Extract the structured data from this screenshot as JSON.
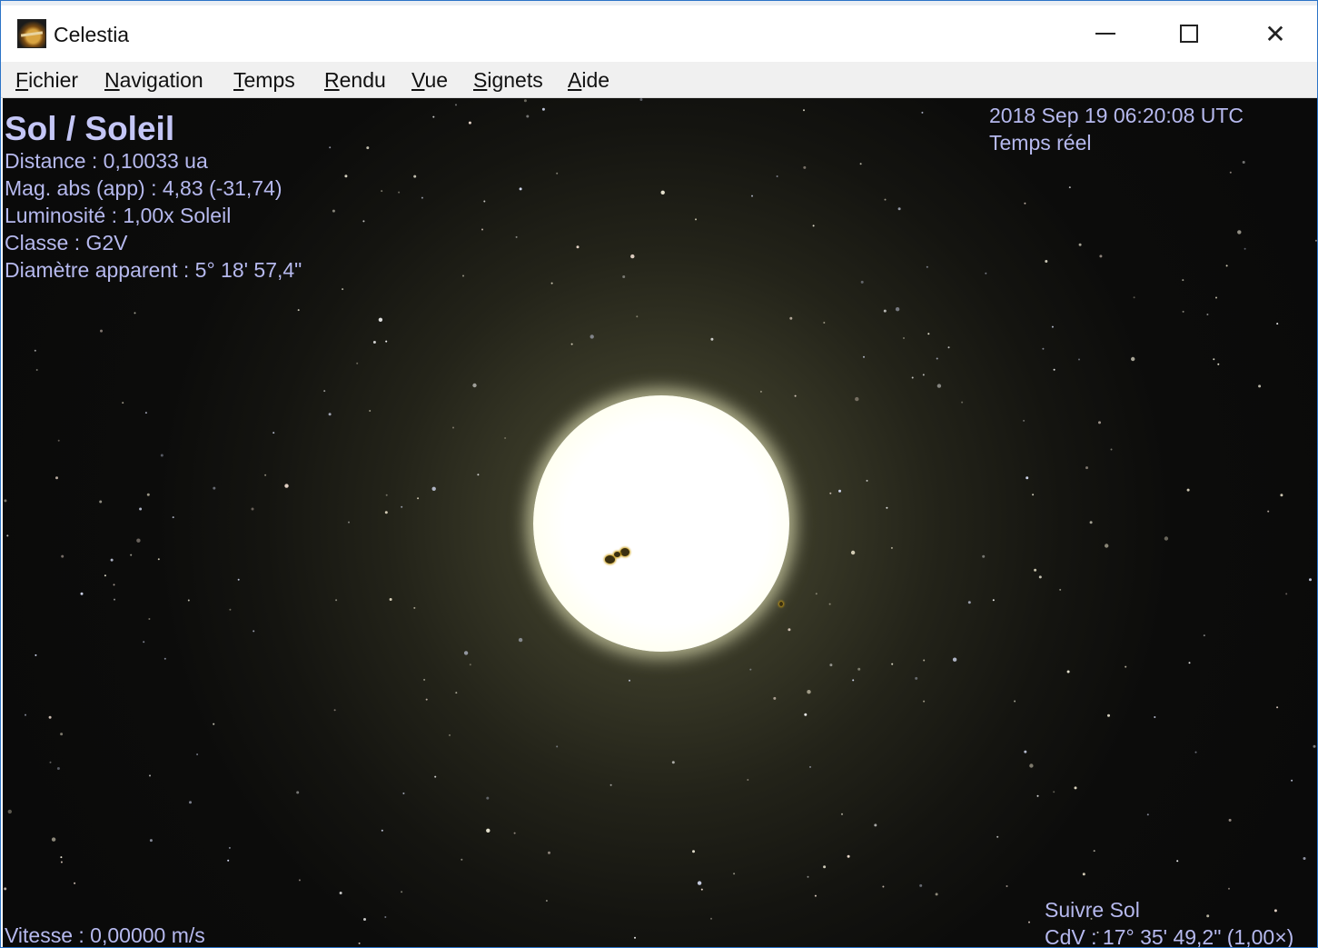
{
  "window": {
    "title": "Celestia"
  },
  "menu": [
    {
      "label": "Fichier",
      "accel": "F",
      "rest": "ichier"
    },
    {
      "label": "Navigation",
      "accel": "N",
      "rest": "avigation"
    },
    {
      "label": "Temps",
      "accel": "T",
      "rest": "emps"
    },
    {
      "label": "Rendu",
      "accel": "R",
      "rest": "endu"
    },
    {
      "label": "Vue",
      "accel": "V",
      "rest": "ue"
    },
    {
      "label": "Signets",
      "accel": "S",
      "rest": "ignets"
    },
    {
      "label": "Aide",
      "accel": "A",
      "rest": "ide"
    }
  ],
  "object_info": {
    "name": "Sol / Soleil",
    "distance": "Distance : 0,10033 ua",
    "magnitude": "Mag. abs (app) : 4,83 (-31,74)",
    "luminosity": "Luminosité : 1,00x Soleil",
    "class": "Classe : G2V",
    "diameter": "Diamètre apparent : 5° 18' 57,4\""
  },
  "time_info": {
    "datetime": "2018 Sep 19 06:20:08 UTC",
    "mode": "Temps réel"
  },
  "status": {
    "speed": "Vitesse : 0,00000 m/s",
    "follow": "Suivre Sol",
    "fov": "CdV : 17° 35' 49,2\" (1,00×)"
  },
  "colors": {
    "hud_text": "#b6b9ee",
    "sky": "#0a0a0a",
    "sun": "#fffff2"
  },
  "icons": {
    "app": "celestia-app-icon",
    "minimize": "minimize-icon",
    "maximize": "maximize-icon",
    "close": "close-icon"
  }
}
